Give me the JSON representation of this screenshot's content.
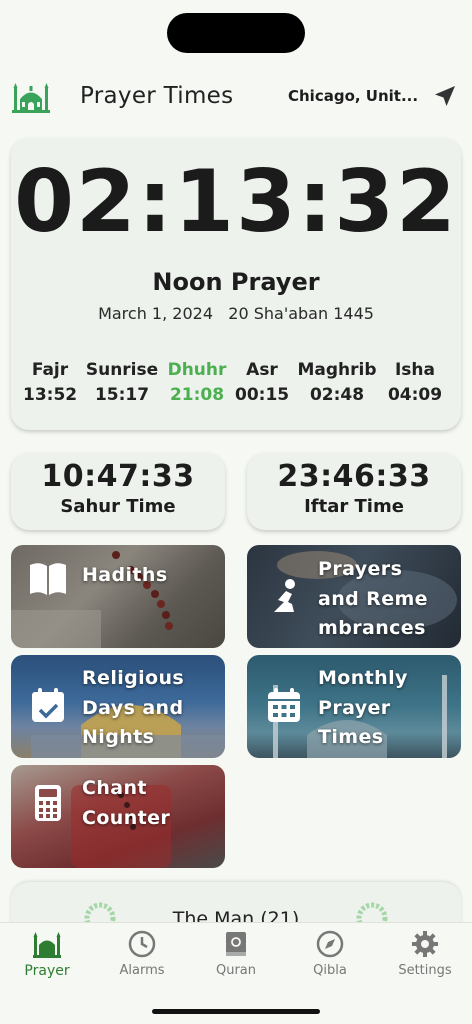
{
  "header": {
    "title": "Prayer Times",
    "location": "Chicago, Unit...",
    "logo_icon": "mosque-icon",
    "location_icon": "navigation-arrow-icon"
  },
  "main": {
    "clock": "02:13:32",
    "current_prayer": "Noon Prayer",
    "gregorian_date": "March 1, 2024",
    "hijri_date": "20 Sha'aban 1445",
    "times": [
      {
        "name": "Fajr",
        "time": "13:52",
        "active": false
      },
      {
        "name": "Sunrise",
        "time": "15:17",
        "active": false
      },
      {
        "name": "Dhuhr",
        "time": "21:08",
        "active": true
      },
      {
        "name": "Asr",
        "time": "00:15",
        "active": false
      },
      {
        "name": "Maghrib",
        "time": "02:48",
        "active": false
      },
      {
        "name": "Isha",
        "time": "04:09",
        "active": false
      }
    ],
    "active_color": "#4caf50"
  },
  "sahur": {
    "time": "10:47:33",
    "label": "Sahur Time"
  },
  "iftar": {
    "time": "23:46:33",
    "label": "Iftar Time"
  },
  "tiles": [
    {
      "lines": [
        "Hadiths"
      ],
      "icon": "open-book-icon"
    },
    {
      "lines": [
        "Prayers",
        "and Reme",
        "mbrances"
      ],
      "icon": "praying-person-icon"
    },
    {
      "lines": [
        "Religious",
        "Days and",
        "Nights"
      ],
      "icon": "calendar-check-icon"
    },
    {
      "lines": [
        "Monthly",
        "Prayer",
        "Times"
      ],
      "icon": "calendar-grid-icon"
    },
    {
      "lines": [
        "Chant",
        "Counter"
      ],
      "icon": "calculator-icon"
    }
  ],
  "bottom_card": {
    "text": "The Man (21)"
  },
  "tabs": [
    {
      "label": "Prayer",
      "icon": "mosque-icon",
      "active": true
    },
    {
      "label": "Alarms",
      "icon": "clock-icon",
      "active": false
    },
    {
      "label": "Quran",
      "icon": "quran-book-icon",
      "active": false
    },
    {
      "label": "Qibla",
      "icon": "compass-icon",
      "active": false
    },
    {
      "label": "Settings",
      "icon": "gear-icon",
      "active": false
    }
  ],
  "colors": {
    "accent": "#2e7d32",
    "card_bg": "#edf2ec",
    "page_bg": "#f6f8f3"
  }
}
